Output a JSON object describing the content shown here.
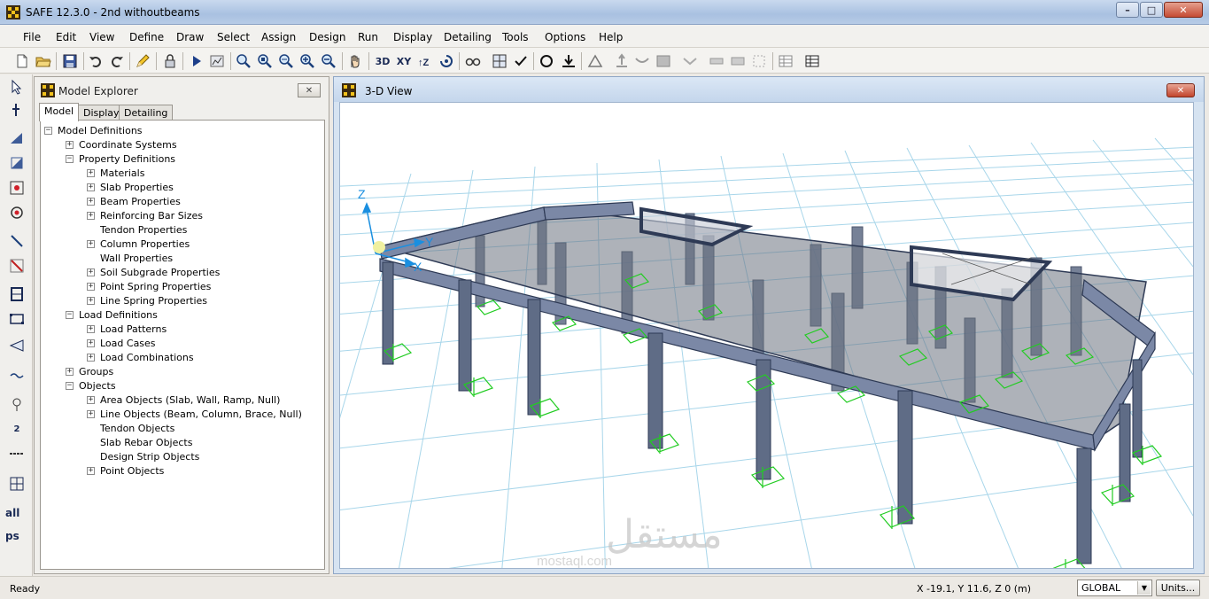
{
  "window": {
    "title": "SAFE 12.3.0 - 2nd withoutbeams",
    "min": "–",
    "max": "□",
    "close": "✕"
  },
  "menu": [
    "File",
    "Edit",
    "View",
    "Define",
    "Draw",
    "Select",
    "Assign",
    "Design",
    "Run",
    "Display",
    "Detailing",
    "Tools",
    "Options",
    "Help"
  ],
  "toolbar": {
    "view_3d": "3D",
    "view_xy": "XY",
    "view_xz": "XZ"
  },
  "lefttools": {
    "all": "all",
    "ps": "ps",
    "dim": "2"
  },
  "explorer": {
    "title": "Model Explorer",
    "close": "✕",
    "tabs": [
      "Model",
      "Display",
      "Detailing"
    ],
    "tree": [
      {
        "label": "Model Definitions",
        "level": 0,
        "state": "expanded"
      },
      {
        "label": "Coordinate Systems",
        "level": 1,
        "state": "collapsed"
      },
      {
        "label": "Property Definitions",
        "level": 1,
        "state": "expanded"
      },
      {
        "label": "Materials",
        "level": 2,
        "state": "collapsed"
      },
      {
        "label": "Slab Properties",
        "level": 2,
        "state": "collapsed"
      },
      {
        "label": "Beam Properties",
        "level": 2,
        "state": "collapsed"
      },
      {
        "label": "Reinforcing Bar Sizes",
        "level": 2,
        "state": "collapsed"
      },
      {
        "label": "Tendon Properties",
        "level": 2,
        "state": "leaf"
      },
      {
        "label": "Column Properties",
        "level": 2,
        "state": "collapsed"
      },
      {
        "label": "Wall Properties",
        "level": 2,
        "state": "leaf"
      },
      {
        "label": "Soil Subgrade Properties",
        "level": 2,
        "state": "collapsed"
      },
      {
        "label": "Point Spring Properties",
        "level": 2,
        "state": "collapsed"
      },
      {
        "label": "Line Spring Properties",
        "level": 2,
        "state": "collapsed"
      },
      {
        "label": "Load Definitions",
        "level": 1,
        "state": "expanded"
      },
      {
        "label": "Load Patterns",
        "level": 2,
        "state": "collapsed"
      },
      {
        "label": "Load Cases",
        "level": 2,
        "state": "collapsed"
      },
      {
        "label": "Load Combinations",
        "level": 2,
        "state": "collapsed"
      },
      {
        "label": "Groups",
        "level": 1,
        "state": "collapsed"
      },
      {
        "label": "Objects",
        "level": 1,
        "state": "expanded"
      },
      {
        "label": "Area Objects (Slab, Wall, Ramp, Null)",
        "level": 2,
        "state": "collapsed"
      },
      {
        "label": "Line Objects (Beam, Column, Brace, Null)",
        "level": 2,
        "state": "collapsed"
      },
      {
        "label": "Tendon Objects",
        "level": 2,
        "state": "leaf"
      },
      {
        "label": "Slab Rebar Objects",
        "level": 2,
        "state": "leaf"
      },
      {
        "label": "Design Strip Objects",
        "level": 2,
        "state": "leaf"
      },
      {
        "label": "Point Objects",
        "level": 2,
        "state": "collapsed"
      }
    ]
  },
  "view": {
    "title": "3-D View",
    "close": "✕",
    "axes": {
      "x": "X",
      "y": "Y",
      "z": "Z"
    },
    "watermark": {
      "arabic": "مستقل",
      "latin": "mostaql.com"
    }
  },
  "status": {
    "text": "Ready",
    "coords": "X -19.1,  Y 11.6,  Z 0  (m)",
    "coord_system": "GLOBAL",
    "units_button": "Units..."
  },
  "colors": {
    "grid": "#a8d6ea",
    "column": "#5f6c86",
    "slab": "#6b7280",
    "support": "#22cc22",
    "axis": "#1a8fe0"
  }
}
